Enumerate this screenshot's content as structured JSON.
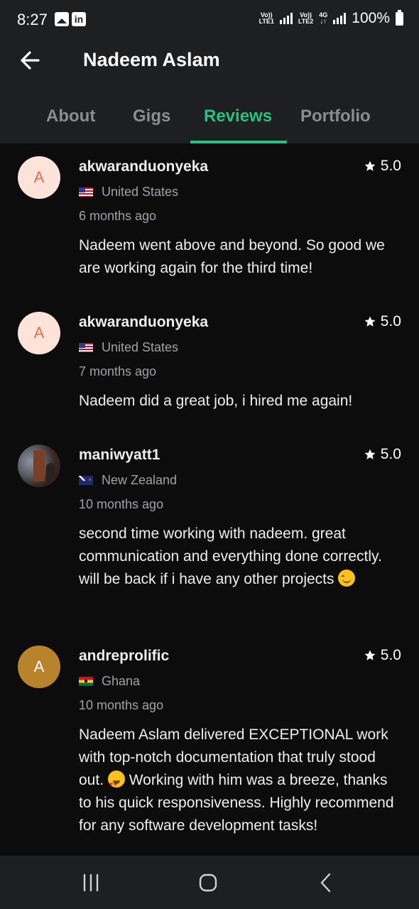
{
  "status_bar": {
    "time": "8:27",
    "battery": "100%",
    "sim1_label": "Vo))\nLTE1",
    "sim2_label": "Vo))\nLTE2",
    "network": "4G"
  },
  "header": {
    "title": "Nadeem Aslam"
  },
  "tabs": [
    {
      "label": "About",
      "active": false
    },
    {
      "label": "Gigs",
      "active": false
    },
    {
      "label": "Reviews",
      "active": true
    },
    {
      "label": "Portfolio",
      "active": false
    }
  ],
  "reviews": [
    {
      "avatar_letter": "A",
      "username": "akwaranduonyeka",
      "rating": "5.0",
      "country": "United States",
      "time_ago": "6 months ago",
      "text": "Nadeem went above and beyond. So good we are working again for the third time!"
    },
    {
      "avatar_letter": "A",
      "username": "akwaranduonyeka",
      "rating": "5.0",
      "country": "United States",
      "time_ago": "7 months ago",
      "text": "Nadeem did a great job, i hired me again!"
    },
    {
      "avatar_letter": "",
      "username": "maniwyatt1",
      "rating": "5.0",
      "country": "New Zealand",
      "time_ago": "10 months ago",
      "text": "second time working with nadeem. great communication and everything done correctly. will be back if i have any other projects",
      "emoji": "smiling-face-icon"
    },
    {
      "avatar_letter": "A",
      "username": "andreprolific",
      "rating": "5.0",
      "country": "Ghana",
      "time_ago": "10 months ago",
      "text_before_emoji": "Nadeem Aslam delivered EXCEPTIONAL work with top-notch documentation that truly stood out.",
      "text_after_emoji": "Working with him was a breeze, thanks to his quick responsiveness. Highly recommend for any software development tasks!",
      "emoji": "heart-eyes-icon"
    }
  ],
  "colors": {
    "accent": "#26c281",
    "background": "#0c0c0d",
    "surface": "#1e1f21",
    "muted_text": "#9ea2a8"
  }
}
